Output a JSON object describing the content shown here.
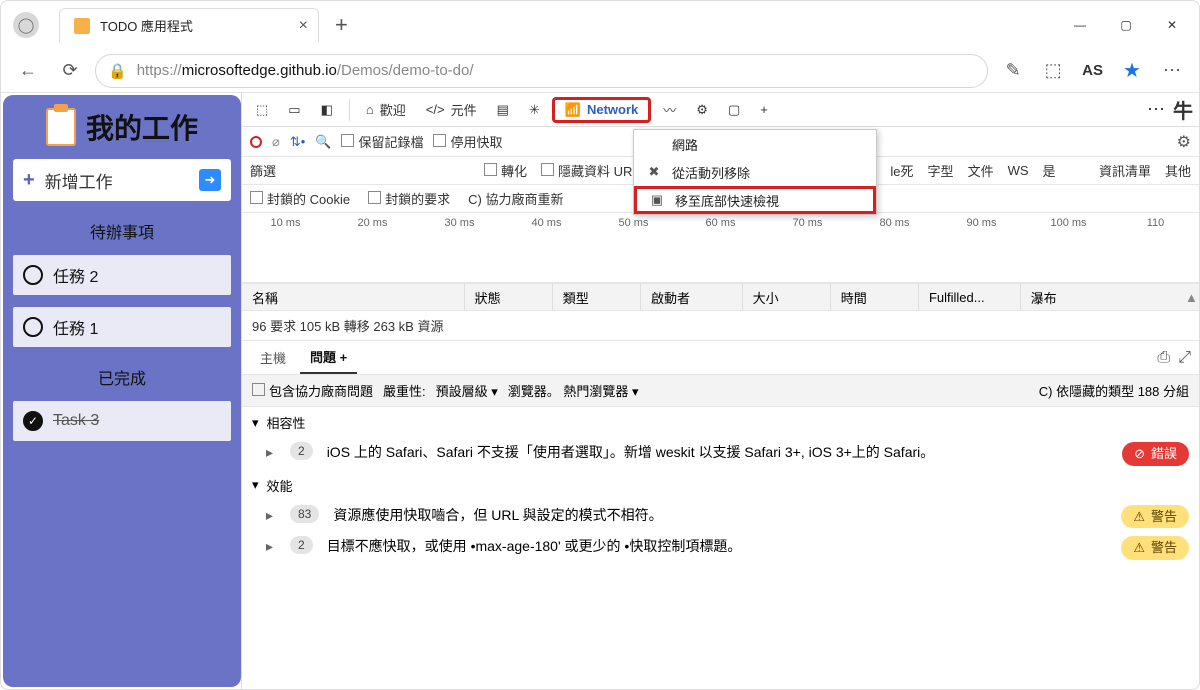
{
  "window": {
    "tab_title": "TODO 應用程式",
    "profile_initials": "AS"
  },
  "url": {
    "scheme": "https://",
    "host": "microsoftedge.github.io",
    "path": "/Demos/demo-to-do/"
  },
  "app": {
    "title": "我的工作",
    "add_label": "新增工作",
    "section_todo": "待辦事項",
    "section_done": "已完成",
    "tasks_todo": [
      "任務 2",
      "任務 1"
    ],
    "tasks_done": [
      "Task 3"
    ]
  },
  "devtools": {
    "tabs": {
      "welcome": "歡迎",
      "elements": "元件",
      "network": "Network"
    },
    "right_glyph": "牛",
    "toolbar": {
      "preserve_log": "保留記錄檔",
      "disable_cache": "停用快取"
    },
    "filter_row": {
      "filter": "篩選",
      "convert": "轉化",
      "hide_url": "隱藏資料 UR",
      "le_death": "le死",
      "font": "字型",
      "file": "文件",
      "ws": "WS",
      "yes": "是",
      "info_list": "資訊清單",
      "other": "其他"
    },
    "filter_row2": {
      "blocked_cookie": "封鎖的 Cookie",
      "blocked_req": "封鎖的要求",
      "thirdparty": "C) 協力廠商重新"
    },
    "context_menu": {
      "title": "網路",
      "remove": "從活動列移除",
      "move_bottom": "移至底部快速檢視"
    },
    "timeline_ms": [
      "10 ms",
      "20 ms",
      "30 ms",
      "40 ms",
      "50 ms",
      "60 ms",
      "70 ms",
      "80 ms",
      "90 ms",
      "100 ms",
      "110"
    ],
    "net_headers": {
      "name": "名稱",
      "status": "狀態",
      "type": "類型",
      "initiator": "啟動者",
      "size": "大小",
      "time": "時間",
      "fulfilled": "Fulfilled...",
      "waterfall": "瀑布"
    },
    "net_status": "96 要求 105 kB 轉移 263 kB 資源",
    "drawer": {
      "host": "主機",
      "issues": "問題",
      "plus": "+"
    },
    "issues_bar": {
      "include_3p": "包含協力廠商問題",
      "severity_label": "嚴重性:",
      "severity_value": "預設層級",
      "browsers": "瀏覽器。 熱門瀏覽器",
      "grouped": "C) 依隱藏的類型 188 分組"
    },
    "categories": {
      "compat": "相容性",
      "perf": "效能"
    },
    "issues": [
      {
        "count": "2",
        "text": "iOS 上的 Safari、Safari 不支援「使用者選取」。新增 weskit 以支援 Safari 3+, iOS 3+上的 Safari。",
        "level": "err",
        "pill": "錯誤"
      },
      {
        "count": "83",
        "text": "資源應使用快取嚙合，但 URL 與設定的模式不相符。",
        "level": "warn",
        "pill": "警告"
      },
      {
        "count": "2",
        "text": "目標不應快取，或使用 •max-age-180' 或更少的 •快取控制項標題。",
        "level": "warn",
        "pill": "警告"
      }
    ]
  }
}
